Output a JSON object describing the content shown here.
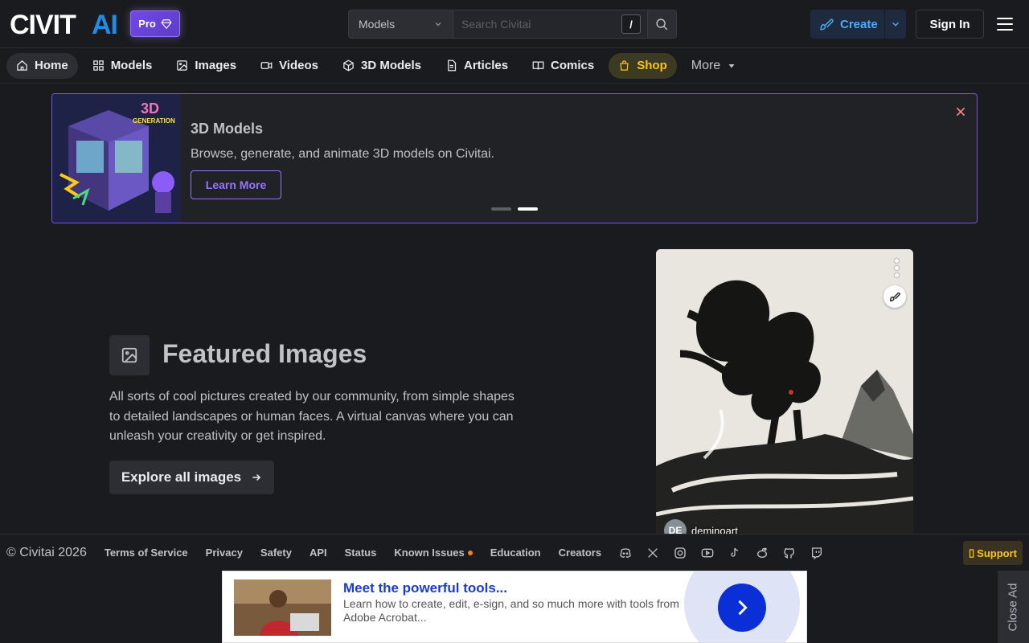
{
  "header": {
    "logo_text": "CIVITAI",
    "pro_label": "Pro",
    "search": {
      "category": "Models",
      "placeholder": "Search Civitai",
      "shortcut_key": "/"
    },
    "create_label": "Create",
    "signin_label": "Sign In"
  },
  "nav": {
    "items": [
      {
        "label": "Home",
        "icon": "home-icon"
      },
      {
        "label": "Models",
        "icon": "grid-icon"
      },
      {
        "label": "Images",
        "icon": "photo-icon"
      },
      {
        "label": "Videos",
        "icon": "video-icon"
      },
      {
        "label": "3D Models",
        "icon": "cube-icon"
      },
      {
        "label": "Articles",
        "icon": "file-icon"
      },
      {
        "label": "Comics",
        "icon": "book-icon"
      },
      {
        "label": "Shop",
        "icon": "bag-icon"
      }
    ],
    "more_label": "More"
  },
  "banner": {
    "title": "3D Models",
    "description": "Browse, generate, and animate 3D models on Civitai.",
    "button_label": "Learn More",
    "image_text_top": "3D",
    "image_text_bottom": "GENERATION",
    "slide_count": 2,
    "active_slide": 2
  },
  "featured": {
    "title": "Featured Images",
    "description": "All sorts of cool pictures created by our community, from simple shapes to detailed landscapes or human faces. A virtual canvas where you can unleash your creativity or get inspired.",
    "button_label": "Explore all images",
    "card": {
      "avatar_initials": "DE",
      "username": "deminoart"
    }
  },
  "footer": {
    "copyright": "© Civitai 2026",
    "links": [
      "Terms of Service",
      "Privacy",
      "Safety",
      "API",
      "Status",
      "Known Issues",
      "Education",
      "Creators"
    ],
    "socials": [
      "discord-icon",
      "x-icon",
      "instagram-icon",
      "youtube-icon",
      "tiktok-icon",
      "reddit-icon",
      "github-icon",
      "twitch-icon"
    ],
    "support_label": "Support"
  },
  "ad": {
    "title": "Meet the powerful tools...",
    "description": "Learn how to create, edit, e-sign, and so much more with tools from Adobe Acrobat...",
    "close_label": "Close Ad"
  },
  "colors": {
    "background": "#1a1b1e",
    "accent_purple": "#7950f2",
    "accent_blue": "#4dabf7",
    "shop_yellow": "#fcc419"
  }
}
